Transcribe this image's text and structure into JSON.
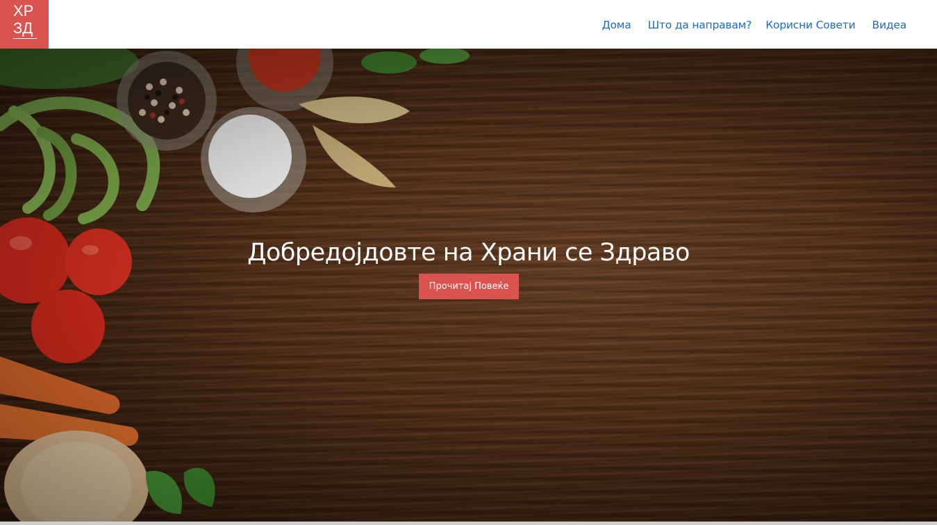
{
  "navbar": {
    "logo_line1": "ХР",
    "logo_line2": "ЗД",
    "links": [
      {
        "label": "Дома"
      },
      {
        "label": "Што да направам?"
      },
      {
        "label": "Корисни Совети"
      },
      {
        "label": "Видеа"
      }
    ]
  },
  "hero": {
    "title": "Добредојдовте на Храни се Здраво",
    "button_label": "Прочитај Повеќе"
  },
  "colors": {
    "accent": "#d9534f",
    "nav_link": "#1a6cbf",
    "hero_bg": "#4d2d18"
  }
}
